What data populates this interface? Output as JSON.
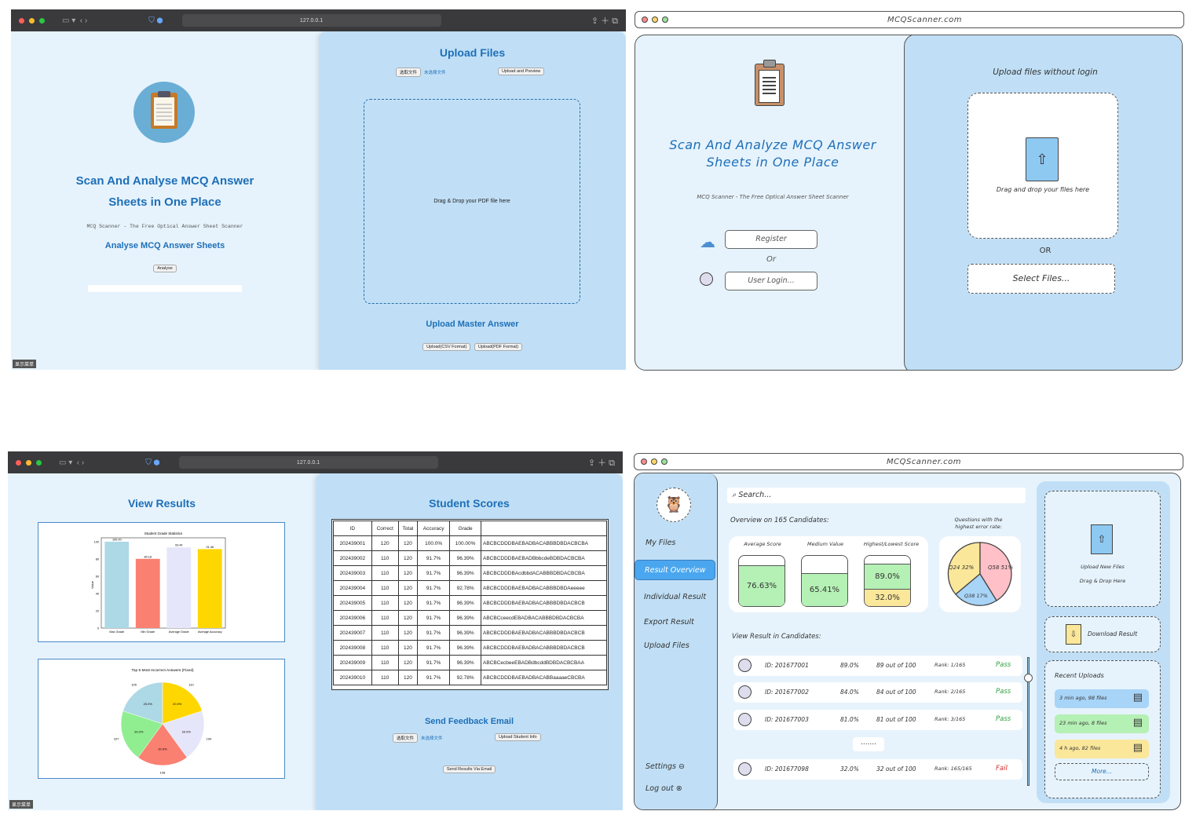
{
  "browser": {
    "url": "127.0.0.1",
    "menu_tag": "显示菜单"
  },
  "p1": {
    "title_line1": "Scan And Analyse MCQ Answer",
    "title_line2": "Sheets in One Place",
    "subtitle": "MCQ Scanner - The Free Optical Answer Sheet Scanner",
    "analyse_heading": "Analyse MCQ Answer Sheets",
    "analyse_button": "Analyse",
    "upload_title": "Upload Files",
    "choose_file": "选取文件",
    "no_file": "未选择文件",
    "upload_preview": "Upload and Preview",
    "drop_text": "Drag & Drop your PDF file here",
    "master_title": "Upload Master Answer",
    "csv_button": "Upload(CSV Format)",
    "pdf_button": "Upload(PDF Format)"
  },
  "p2": {
    "url": "MCQScanner.com",
    "title_line1": "Scan And Analyze MCQ Answer",
    "title_line2": "Sheets in One Place",
    "subtitle": "MCQ Scanner - The Free Optical Answer Sheet Scanner",
    "register": "Register",
    "or": "Or",
    "login": "User Login...",
    "upload_heading": "Upload files without login",
    "drop_text": "Drag and drop your files here",
    "or2": "OR",
    "select_files": "Select Files..."
  },
  "p3": {
    "view_title": "View Results",
    "scores_title": "Student Scores",
    "feedback_title": "Send Feedback Email",
    "choose_file": "选取文件",
    "no_file": "未选择文件",
    "upload_student": "Upload Student Info",
    "send_results": "Send Results Via Email",
    "table_headers": [
      "ID",
      "Correct",
      "Total",
      "Accuracy",
      "Grade",
      ""
    ],
    "table_rows": [
      [
        "202439001",
        "120",
        "120",
        "100.0%",
        "100.00%",
        "ABCBCDDDBAEBADBACABBBDBDACBCBA"
      ],
      [
        "202439002",
        "110",
        "120",
        "91.7%",
        "96.39%",
        "ABCBCDDDBAEBADBbbcdeBDBDACBCBA"
      ],
      [
        "202439003",
        "110",
        "120",
        "91.7%",
        "96.39%",
        "ABCBCDDDBAcdbbdACABBBDBDACBCBA"
      ],
      [
        "202439004",
        "110",
        "120",
        "91.7%",
        "92.78%",
        "ABCBCDDDBAEBADBACABBBDBDAeeeee"
      ],
      [
        "202439005",
        "110",
        "120",
        "91.7%",
        "96.39%",
        "ABCBCDDDBAEBADBACABBBDBDACBCB"
      ],
      [
        "202439006",
        "110",
        "120",
        "91.7%",
        "96.39%",
        "ABCBCceecdEBADBACABBBDBDACBCBA"
      ],
      [
        "202439007",
        "110",
        "120",
        "91.7%",
        "96.39%",
        "ABCBCDDDBAEBADBACABBBDBDACBCB"
      ],
      [
        "202439008",
        "110",
        "120",
        "91.7%",
        "96.39%",
        "ABCBCDDDBAEBADBACABBBDBDACBCB"
      ],
      [
        "202439009",
        "110",
        "120",
        "91.7%",
        "96.39%",
        "ABCBCecbeeEBADBdbcddBDBDACBCBAA"
      ],
      [
        "202439010",
        "110",
        "120",
        "91.7%",
        "92.78%",
        "ABCBCDDDBAEBADBACABBaaaaeCBCBA"
      ]
    ]
  },
  "chart_data": [
    {
      "type": "bar",
      "title": "Student Grade Statistics",
      "ylabel": "Value",
      "categories": [
        "Max Grade",
        "Min Grade",
        "Average Grade",
        "Average Accuracy"
      ],
      "values": [
        100.0,
        80.18,
        93.44,
        91.46
      ],
      "ylim": [
        0,
        100
      ],
      "colors": [
        "#add8e6",
        "#fa8072",
        "#e6e6fa",
        "#ffd700"
      ]
    },
    {
      "type": "pie",
      "title": "Top 5 Most Incorrect Answers (Fixed)",
      "categories": [
        "105",
        "110",
        "109",
        "108",
        "107"
      ],
      "values": [
        20.0,
        20.0,
        20.0,
        20.0,
        20.0
      ],
      "colors": [
        "#add8e6",
        "#ffd700",
        "#e6e6fa",
        "#fa8072",
        "#90ee90"
      ]
    }
  ],
  "p4": {
    "url": "MCQScanner.com",
    "search": "Search...",
    "nav": [
      "My Files",
      "Result Overview",
      "Individual Result",
      "Export Result",
      "Upload Files"
    ],
    "settings": "Settings",
    "logout": "Log out",
    "overview_title": "Overview on 165 Candidates:",
    "error_title_1": "Questions with the",
    "error_title_2": "highest error rate:",
    "avg_label": "Average Score",
    "avg_value": "76.63%",
    "median_label": "Medium Value",
    "median_value": "65.41%",
    "hl_label": "Highest/Lowest Score",
    "high_value": "89.0%",
    "low_value": "32.0%",
    "pie_labels": [
      "Q24 32%",
      "Q58 51%",
      "Q38 17%"
    ],
    "view_title": "View Result in Candidates:",
    "rows": [
      {
        "id": "ID: 201677001",
        "pct": "89.0%",
        "score": "89 out of 100",
        "rank": "Rank: 1/165",
        "status": "Pass"
      },
      {
        "id": "ID: 201677002",
        "pct": "84.0%",
        "score": "84 out of 100",
        "rank": "Rank: 2/165",
        "status": "Pass"
      },
      {
        "id": "ID: 201677003",
        "pct": "81.0%",
        "score": "81 out of 100",
        "rank": "Rank: 3/165",
        "status": "Pass"
      },
      {
        "id": "ID: 201677098",
        "pct": "32.0%",
        "score": "32 out of 100",
        "rank": "Rank: 165/165",
        "status": "Fail"
      }
    ],
    "ellipsis": ".......",
    "upload_new": "Upload New Files",
    "drag_drop": "Drag & Drop Here",
    "download": "Download Result",
    "recent_title": "Recent Uploads",
    "recent": [
      "3 min ago, 98 files",
      "23 min ago, 8 files",
      "4 h ago, 82 files"
    ],
    "more": "More...",
    "colors": {
      "green": "#b5f0b5",
      "yellow": "#fbe79a",
      "blue": "#a8d4f7",
      "pass": "#2e9e3e",
      "fail": "#d62b2b"
    }
  }
}
